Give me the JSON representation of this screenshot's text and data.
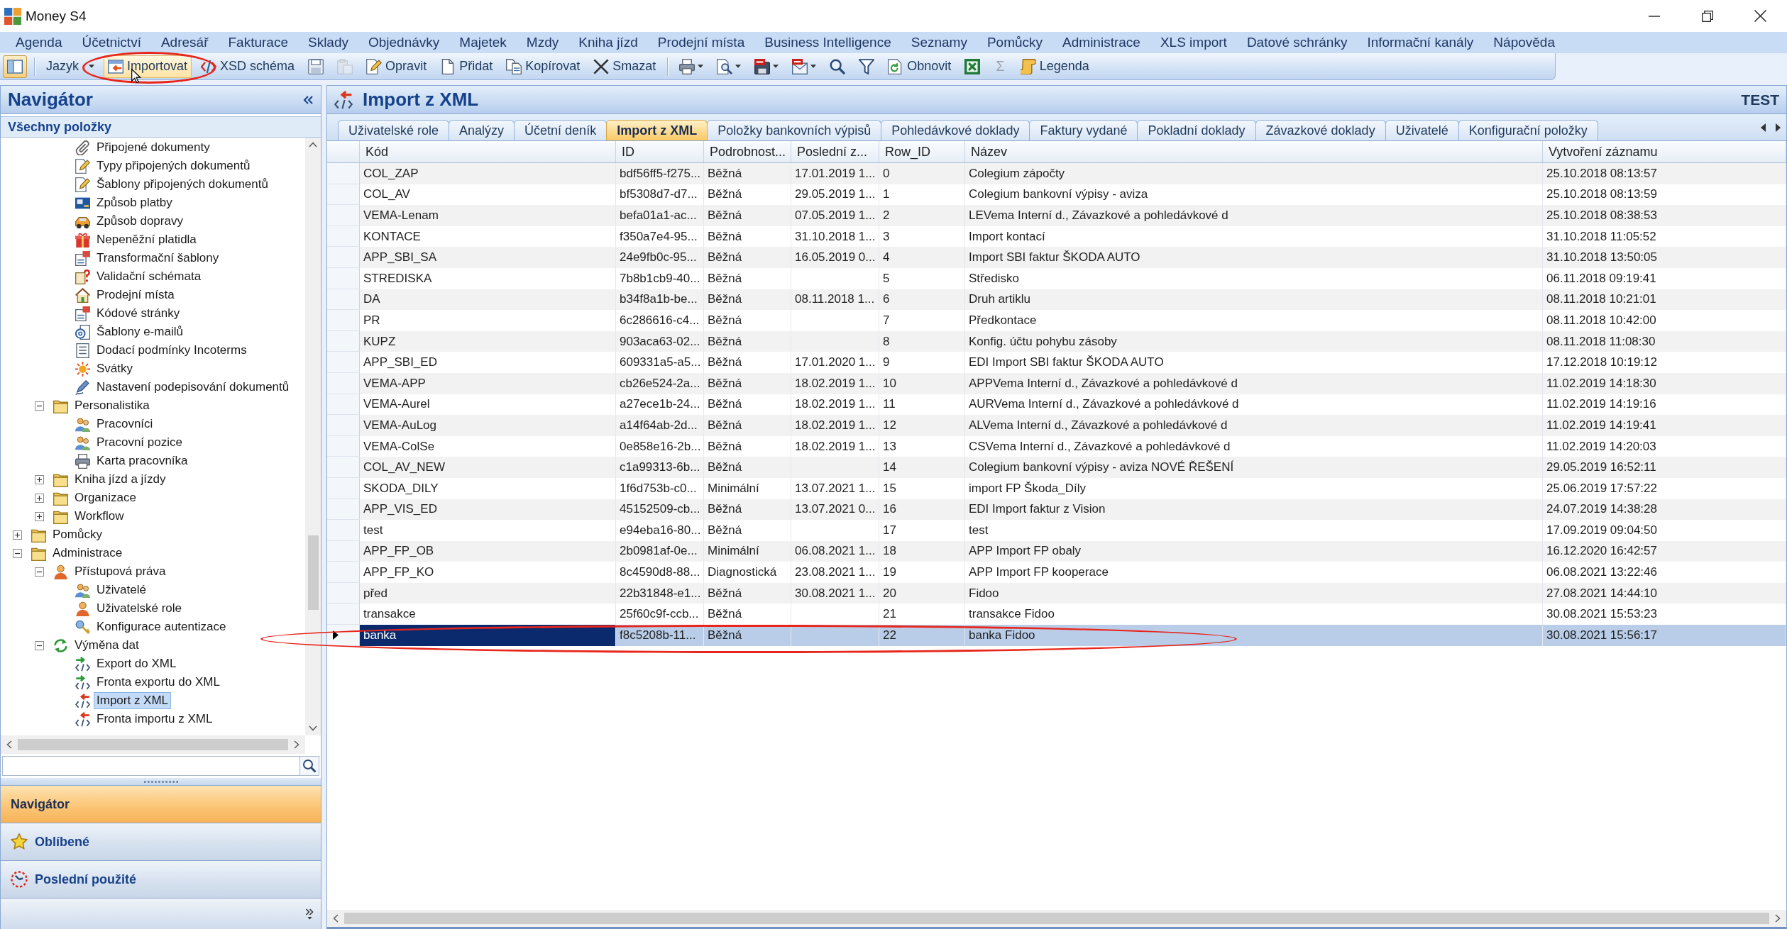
{
  "window": {
    "title": "Money S4"
  },
  "menu": [
    "Agenda",
    "Účetnictví",
    "Adresář",
    "Fakturace",
    "Sklady",
    "Objednávky",
    "Majetek",
    "Mzdy",
    "Kniha jízd",
    "Prodejní místa",
    "Business Intelligence",
    "Seznamy",
    "Pomůcky",
    "Administrace",
    "XLS import",
    "Datové schránky",
    "Informační kanály",
    "Nápověda"
  ],
  "toolbar": {
    "groups": [
      [
        {
          "kind": "toggle",
          "on": true,
          "disabled": false,
          "hovered": false,
          "circled": false
        }
      ],
      [
        {
          "kind": "dropdown",
          "label": "Jazyk",
          "disabled": false,
          "hovered": false,
          "circled": false
        },
        {
          "kind": "button",
          "label": "Importovat",
          "disabled": false,
          "hovered": true,
          "circled": true
        },
        {
          "kind": "button",
          "label": "XSD schéma",
          "disabled": false,
          "hovered": false,
          "circled": false
        },
        {
          "kind": "icon",
          "disabled": false,
          "hovered": false,
          "circled": false
        },
        {
          "kind": "icon",
          "disabled": true,
          "hovered": false,
          "circled": false
        },
        {
          "kind": "button",
          "label": "Opravit",
          "disabled": false,
          "hovered": false,
          "circled": false
        },
        {
          "kind": "button",
          "label": "Přidat",
          "disabled": false,
          "hovered": false,
          "circled": false
        },
        {
          "kind": "button",
          "label": "Kopírovat",
          "disabled": false,
          "hovered": false,
          "circled": false
        },
        {
          "kind": "button",
          "label": "Smazat",
          "disabled": false,
          "hovered": false,
          "circled": false
        }
      ],
      [
        {
          "kind": "icon-dropdown",
          "disabled": false,
          "hovered": false,
          "circled": false
        },
        {
          "kind": "icon-dropdown",
          "disabled": false,
          "hovered": false,
          "circled": false
        },
        {
          "kind": "icon-dropdown",
          "disabled": false,
          "hovered": false,
          "circled": false
        },
        {
          "kind": "icon-dropdown",
          "disabled": false,
          "hovered": false,
          "circled": false
        },
        {
          "kind": "icon",
          "disabled": false,
          "hovered": false,
          "circled": false
        },
        {
          "kind": "icon",
          "disabled": false,
          "hovered": false,
          "circled": false
        },
        {
          "kind": "button",
          "label": "Obnovit",
          "disabled": false,
          "hovered": false,
          "circled": false
        },
        {
          "kind": "icon",
          "disabled": false,
          "hovered": false,
          "circled": false
        },
        {
          "kind": "glyph",
          "label": "Σ",
          "disabled": true,
          "hovered": false,
          "circled": false
        },
        {
          "kind": "button",
          "label": "Legenda",
          "disabled": false,
          "hovered": false,
          "circled": false
        }
      ]
    ]
  },
  "navigator": {
    "title": "Navigátor",
    "section": "Všechny položky",
    "tree": [
      {
        "children": [
          {
            "children": [
              {
                "label": "Připojené dokumenty",
                "selected": false
              },
              {
                "label": "Typy připojených dokumentů",
                "selected": false
              },
              {
                "label": "Šablony připojených dokumentů",
                "selected": false
              },
              {
                "label": "Způsob platby",
                "selected": false
              },
              {
                "label": "Způsob dopravy",
                "selected": false
              },
              {
                "label": "Nepeněžní platidla",
                "selected": false
              },
              {
                "label": "Transformační šablony",
                "selected": false
              },
              {
                "label": "Validační schémata",
                "selected": false
              },
              {
                "label": "Prodejní místa",
                "selected": false
              },
              {
                "label": "Kódové stránky",
                "selected": false
              },
              {
                "label": "Šablony e-mailů",
                "selected": false
              },
              {
                "label": "Dodací podmínky Incoterms",
                "selected": false
              },
              {
                "label": "Svátky",
                "selected": false
              },
              {
                "label": "Nastavení podepisování dokumentů",
                "selected": false
              }
            ]
          },
          {
            "label": "Personalistika",
            "expanded": true,
            "selected": false,
            "children": [
              {
                "label": "Pracovníci",
                "selected": false
              },
              {
                "label": "Pracovní pozice",
                "selected": false
              },
              {
                "label": "Karta pracovníka",
                "selected": false
              }
            ]
          },
          {
            "label": "Kniha jízd a jízdy",
            "expanded": false,
            "selected": false
          },
          {
            "label": "Organizace",
            "expanded": false,
            "selected": false
          },
          {
            "label": "Workflow",
            "expanded": false,
            "selected": false
          }
        ]
      },
      {
        "label": "Pomůcky",
        "expanded": false,
        "selected": false
      },
      {
        "label": "Administrace",
        "expanded": true,
        "selected": false,
        "children": [
          {
            "label": "Přístupová práva",
            "expanded": true,
            "selected": false,
            "children": [
              {
                "label": "Uživatelé",
                "selected": false
              },
              {
                "label": "Uživatelské role",
                "selected": false
              },
              {
                "label": "Konfigurace autentizace",
                "selected": false
              }
            ]
          },
          {
            "label": "Výměna dat",
            "expanded": true,
            "selected": false,
            "children": [
              {
                "label": "Export do XML",
                "selected": false
              },
              {
                "label": "Fronta exportu do XML",
                "selected": false
              },
              {
                "label": "Import z XML",
                "selected": true
              },
              {
                "label": "Fronta importu z XML",
                "selected": false
              }
            ]
          }
        ]
      }
    ],
    "panes": [
      {
        "label": "Navigátor",
        "selected": true
      },
      {
        "label": "Oblíbené",
        "selected": false
      },
      {
        "label": "Poslední použité",
        "selected": false
      }
    ]
  },
  "document": {
    "title": "Import z XML",
    "badge": "TEST",
    "tabs": [
      {
        "label": "Uživatelské role",
        "selected": false
      },
      {
        "label": "Analýzy",
        "selected": false
      },
      {
        "label": "Účetní deník",
        "selected": false
      },
      {
        "label": "Import z XML",
        "selected": true
      },
      {
        "label": "Položky bankovních výpisů",
        "selected": false
      },
      {
        "label": "Pohledávkové doklady",
        "selected": false
      },
      {
        "label": "Faktury vydané",
        "selected": false
      },
      {
        "label": "Pokladní doklady",
        "selected": false
      },
      {
        "label": "Závazkové doklady",
        "selected": false
      },
      {
        "label": "Uživatelé",
        "selected": false
      },
      {
        "label": "Konfigurační položky",
        "selected": false
      }
    ],
    "table": {
      "columns": [
        "Kód",
        "ID",
        "Podrobnost...",
        "Poslední z...",
        "Row_ID",
        "Název",
        "Vytvoření záznamu"
      ],
      "rows": [
        {
          "kod": "COL_ZAP",
          "id": "bdf56ff5-f275...",
          "podrobnost": "Běžná",
          "posledni_z": "17.01.2019 1...",
          "row_id": "0",
          "nazev": "Colegium zápočty",
          "vytvoreni_zaznamu": "25.10.2018 08:13:57",
          "selected": false,
          "circled": false
        },
        {
          "kod": "COL_AV",
          "id": "bf5308d7-d7...",
          "podrobnost": "Běžná",
          "posledni_z": "29.05.2019 1...",
          "row_id": "1",
          "nazev": "Colegium bankovní výpisy - aviza",
          "vytvoreni_zaznamu": "25.10.2018 08:13:59",
          "selected": false,
          "circled": false
        },
        {
          "kod": "VEMA-Lenam",
          "id": "befa01a1-ac...",
          "podrobnost": "Běžná",
          "posledni_z": "07.05.2019 1...",
          "row_id": "2",
          "nazev": "LEVema Interní d., Závazkové a pohledávkové d",
          "vytvoreni_zaznamu": "25.10.2018 08:38:53",
          "selected": false,
          "circled": false
        },
        {
          "kod": "KONTACE",
          "id": "f350a7e4-95...",
          "podrobnost": "Běžná",
          "posledni_z": "31.10.2018 1...",
          "row_id": "3",
          "nazev": "Import kontací",
          "vytvoreni_zaznamu": "31.10.2018 11:05:52",
          "selected": false,
          "circled": false
        },
        {
          "kod": "APP_SBI_SA",
          "id": "24e9fb0c-95...",
          "podrobnost": "Běžná",
          "posledni_z": "16.05.2019 0...",
          "row_id": "4",
          "nazev": "Import SBI faktur ŠKODA AUTO",
          "vytvoreni_zaznamu": "31.10.2018 13:50:05",
          "selected": false,
          "circled": false
        },
        {
          "kod": "STREDISKA",
          "id": "7b8b1cb9-40...",
          "podrobnost": "Běžná",
          "row_id": "5",
          "nazev": "Středisko",
          "vytvoreni_zaznamu": "06.11.2018 09:19:41",
          "selected": false,
          "circled": false
        },
        {
          "kod": "DA",
          "id": "b34f8a1b-be...",
          "podrobnost": "Běžná",
          "posledni_z": "08.11.2018 1...",
          "row_id": "6",
          "nazev": "Druh artiklu",
          "vytvoreni_zaznamu": "08.11.2018 10:21:01",
          "selected": false,
          "circled": false
        },
        {
          "kod": "PR",
          "id": "6c286616-c4...",
          "podrobnost": "Běžná",
          "row_id": "7",
          "nazev": "Předkontace",
          "vytvoreni_zaznamu": "08.11.2018 10:42:00",
          "selected": false,
          "circled": false
        },
        {
          "kod": "KUPZ",
          "id": "903aca63-02...",
          "podrobnost": "Běžná",
          "row_id": "8",
          "nazev": "Konfig. účtu pohybu zásoby",
          "vytvoreni_zaznamu": "08.11.2018 11:08:30",
          "selected": false,
          "circled": false
        },
        {
          "kod": "APP_SBI_ED",
          "id": "609331a5-a5...",
          "podrobnost": "Běžná",
          "posledni_z": "17.01.2020 1...",
          "row_id": "9",
          "nazev": "EDI Import SBI faktur ŠKODA AUTO",
          "vytvoreni_zaznamu": "17.12.2018 10:19:12",
          "selected": false,
          "circled": false
        },
        {
          "kod": "VEMA-APP",
          "id": "cb26e524-2a...",
          "podrobnost": "Běžná",
          "posledni_z": "18.02.2019 1...",
          "row_id": "10",
          "nazev": "APPVema Interní d., Závazkové a pohledávkové d",
          "vytvoreni_zaznamu": "11.02.2019 14:18:30",
          "selected": false,
          "circled": false
        },
        {
          "kod": "VEMA-Aurel",
          "id": "a27ece1b-24...",
          "podrobnost": "Běžná",
          "posledni_z": "18.02.2019 1...",
          "row_id": "11",
          "nazev": "AURVema Interní d., Závazkové a pohledávkové d",
          "vytvoreni_zaznamu": "11.02.2019 14:19:16",
          "selected": false,
          "circled": false
        },
        {
          "kod": "VEMA-AuLog",
          "id": "a14f64ab-2d...",
          "podrobnost": "Běžná",
          "posledni_z": "18.02.2019 1...",
          "row_id": "12",
          "nazev": "ALVema Interní d., Závazkové a pohledávkové d",
          "vytvoreni_zaznamu": "11.02.2019 14:19:41",
          "selected": false,
          "circled": false
        },
        {
          "kod": "VEMA-ColSe",
          "id": "0e858e16-2b...",
          "podrobnost": "Běžná",
          "posledni_z": "18.02.2019 1...",
          "row_id": "13",
          "nazev": "CSVema Interní d., Závazkové a pohledávkové d",
          "vytvoreni_zaznamu": "11.02.2019 14:20:03",
          "selected": false,
          "circled": false
        },
        {
          "kod": "COL_AV_NEW",
          "id": "c1a99313-6b...",
          "podrobnost": "Běžná",
          "row_id": "14",
          "nazev": "Colegium bankovní výpisy - aviza NOVÉ ŘEŠENÍ",
          "vytvoreni_zaznamu": "29.05.2019 16:52:11",
          "selected": false,
          "circled": false
        },
        {
          "kod": "SKODA_DILY",
          "id": "1f6d753b-c0...",
          "podrobnost": "Minimální",
          "posledni_z": "13.07.2021 1...",
          "row_id": "15",
          "nazev": "import FP Škoda_Díly",
          "vytvoreni_zaznamu": "25.06.2019 17:57:22",
          "selected": false,
          "circled": false
        },
        {
          "kod": "APP_VIS_ED",
          "id": "45152509-cb...",
          "podrobnost": "Běžná",
          "posledni_z": "13.07.2021 0...",
          "row_id": "16",
          "nazev": "EDI Import faktur z Vision",
          "vytvoreni_zaznamu": "24.07.2019 14:38:28",
          "selected": false,
          "circled": false
        },
        {
          "kod": "test",
          "id": "e94eba16-80...",
          "podrobnost": "Běžná",
          "row_id": "17",
          "nazev": "test",
          "vytvoreni_zaznamu": "17.09.2019 09:04:50",
          "selected": false,
          "circled": false
        },
        {
          "kod": "APP_FP_OB",
          "id": "2b0981af-0e...",
          "podrobnost": "Minimální",
          "posledni_z": "06.08.2021 1...",
          "row_id": "18",
          "nazev": "APP Import FP obaly",
          "vytvoreni_zaznamu": "16.12.2020 16:42:57",
          "selected": false,
          "circled": false
        },
        {
          "kod": "APP_FP_KO",
          "id": "8c4590d8-88...",
          "podrobnost": "Diagnostická",
          "posledni_z": "23.08.2021 1...",
          "row_id": "19",
          "nazev": "APP Import FP kooperace",
          "vytvoreni_zaznamu": "06.08.2021 13:22:46",
          "selected": false,
          "circled": false
        },
        {
          "kod": "před",
          "id": "22b31848-e1...",
          "podrobnost": "Běžná",
          "posledni_z": "30.08.2021 1...",
          "row_id": "20",
          "nazev": "Fidoo",
          "vytvoreni_zaznamu": "27.08.2021 14:44:10",
          "selected": false,
          "circled": false
        },
        {
          "kod": "transakce",
          "id": "25f60c9f-ccb...",
          "podrobnost": "Běžná",
          "row_id": "21",
          "nazev": "transakce Fidoo",
          "vytvoreni_zaznamu": "30.08.2021 15:53:23",
          "selected": false,
          "circled": false
        },
        {
          "kod": "banka",
          "id": "f8c5208b-11...",
          "podrobnost": "Běžná",
          "row_id": "22",
          "nazev": "banka Fidoo",
          "vytvoreni_zaznamu": "30.08.2021 15:56:17",
          "selected": true,
          "circled": true
        }
      ]
    }
  }
}
